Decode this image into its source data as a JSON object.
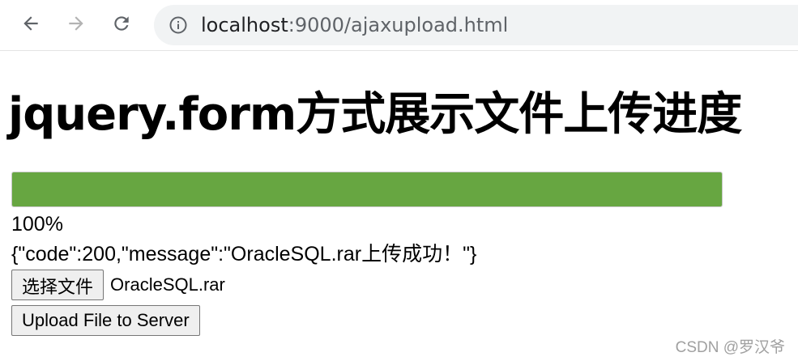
{
  "browser": {
    "url_host": "localhost",
    "url_rest": ":9000/ajaxupload.html",
    "icons": [
      "back-arrow-icon",
      "forward-arrow-icon",
      "reload-icon",
      "info-icon"
    ]
  },
  "page": {
    "title": "jquery.form方式展示文件上传进度",
    "progress": {
      "value_percent": 100,
      "bar_color": "#67a641"
    },
    "percent_text": "100%",
    "response_text": "{\"code\":200,\"message\":\"OracleSQL.rar上传成功！\"}",
    "file_input": {
      "button_label": "选择文件",
      "selected_file": "OracleSQL.rar"
    },
    "upload_button_label": "Upload File to Server"
  },
  "watermark": "CSDN @罗汉爷"
}
